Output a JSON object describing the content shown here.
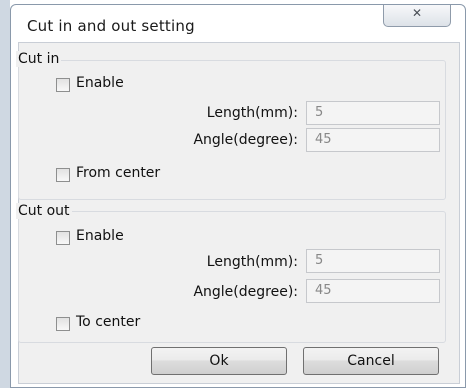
{
  "dialog": {
    "title": "Cut in and out setting",
    "close_glyph": "✕"
  },
  "cut_in": {
    "group_label": "Cut in",
    "enable_label": "Enable",
    "enable_checked": false,
    "length_label": "Length(mm):",
    "length_value": "5",
    "angle_label": "Angle(degree):",
    "angle_value": "45",
    "center_label": "From center",
    "center_checked": false
  },
  "cut_out": {
    "group_label": "Cut out",
    "enable_label": "Enable",
    "enable_checked": false,
    "length_label": "Length(mm):",
    "length_value": "5",
    "angle_label": "Angle(degree):",
    "angle_value": "45",
    "center_label": "To center",
    "center_checked": false
  },
  "buttons": {
    "ok_label": "Ok",
    "cancel_label": "Cancel"
  }
}
